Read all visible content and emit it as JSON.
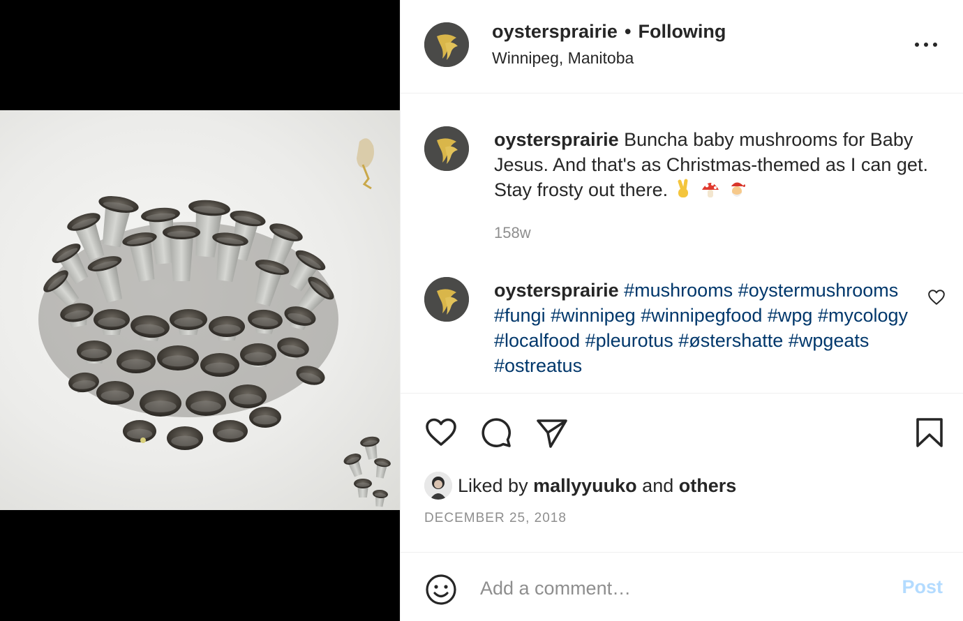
{
  "post": {
    "photo_alt": "oyster mushroom cluster",
    "author": {
      "username": "oystersprairie",
      "follow_separator": "•",
      "follow_status": "Following",
      "location": "Winnipeg, Manitoba"
    },
    "caption": {
      "username": "oystersprairie",
      "text": "Buncha baby mushrooms for Baby Jesus. And that's as Christmas-themed as I can get. Stay frosty out there.",
      "emojis": [
        "victory-hand-emoji",
        "mushroom-emoji",
        "santa-emoji"
      ],
      "age": "158w"
    },
    "hashtag_comment": {
      "username": "oystersprairie",
      "hashtags": [
        "#mushrooms",
        "#oystermushrooms",
        "#fungi",
        "#winnipeg",
        "#winnipegfood",
        "#wpg",
        "#mycology",
        "#localfood",
        "#pleurotus",
        "#østershatte",
        "#wpgeats",
        "#ostreatus"
      ]
    },
    "likes": {
      "prefix": "Liked by",
      "user": "mallyyuuko",
      "connector": "and",
      "others": "others"
    },
    "date": "DECEMBER 25, 2018",
    "composer": {
      "placeholder": "Add a comment…",
      "post_label": "Post"
    }
  },
  "colors": {
    "text": "#262626",
    "muted": "#8e8e8e",
    "hashtag": "#00376b",
    "post_disabled": "#b3dbff",
    "divider": "#efefef",
    "logo_gold": "#d9b64a"
  }
}
